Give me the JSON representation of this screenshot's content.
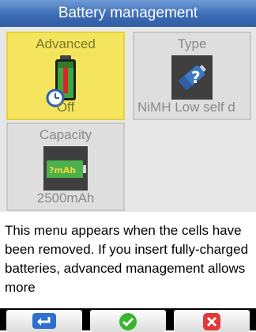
{
  "title": "Battery management",
  "tiles": {
    "advanced": {
      "label": "Advanced",
      "value": "Off"
    },
    "type": {
      "label": "Type",
      "value": "NiMH Low self d"
    },
    "capacity": {
      "label": "Capacity",
      "value": "2500mAh",
      "icon_text": "?mAh"
    }
  },
  "description": "This menu appears when the cells have been removed.  If you insert fully-charged batteries,  advanced management allows  more",
  "buttons": {
    "back": {
      "icon": "enter-arrow-icon"
    },
    "ok": {
      "icon": "check-icon"
    },
    "cancel": {
      "icon": "close-icon"
    }
  },
  "colors": {
    "title_bar": "#3d6db5",
    "selected_tile": "#f4e45e",
    "ok_green": "#38b52f",
    "cancel_red": "#e03a3a",
    "back_blue": "#2f6fd0"
  }
}
